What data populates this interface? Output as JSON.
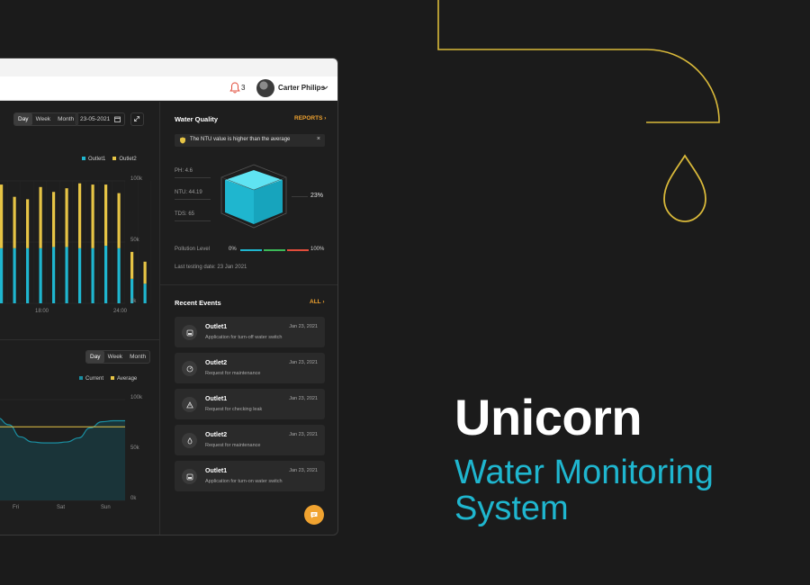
{
  "branding": {
    "title": "Unicorn",
    "subtitle": "Water Monitoring System"
  },
  "colors": {
    "accent_cyan": "#1fb6cf",
    "accent_yellow": "#e6c445",
    "accent_orange": "#f0a330",
    "pollution_red": "#e24d3b",
    "pollution_green": "#3cba58",
    "background": "#1b1b1b"
  },
  "header": {
    "notification_icon": "bell-icon",
    "notification_count": "3",
    "user_name": "Carter Philips",
    "menu_icon": "chevron-down-icon"
  },
  "usage_panel": {
    "range_buttons": [
      "Day",
      "Week",
      "Month"
    ],
    "active_range": "Day",
    "date": "23-05-2021",
    "legend": [
      "Outlet1",
      "Outlet2"
    ],
    "y_ticks": [
      "100k",
      "50k",
      "0k"
    ],
    "x_ticks": [
      "18:00",
      "24:00"
    ]
  },
  "flow_panel": {
    "range_buttons": [
      "Day",
      "Week",
      "Month"
    ],
    "active_range": "Day",
    "legend": [
      "Current",
      "Average"
    ],
    "y_ticks": [
      "100k",
      "50k",
      "0k"
    ],
    "x_ticks": [
      "Fri",
      "Sat",
      "Sun"
    ]
  },
  "chart_data": [
    {
      "type": "bar",
      "stacked": true,
      "series": [
        {
          "name": "Outlet1",
          "color": "#1fb6cf",
          "values": [
            45,
            45,
            45,
            45,
            46,
            46,
            45,
            45,
            47,
            45,
            20,
            16
          ]
        },
        {
          "name": "Outlet2",
          "color": "#e6c445",
          "values": [
            52,
            42,
            40,
            50,
            45,
            48,
            53,
            52,
            50,
            45,
            22,
            18
          ]
        }
      ],
      "ylim": [
        0,
        100
      ],
      "grid": true,
      "legend": "top-right"
    },
    {
      "type": "area",
      "series": [
        {
          "name": "Current",
          "color": "#1fb6cf",
          "values": [
            82,
            75,
            63,
            58,
            57,
            57,
            58,
            62,
            72,
            78,
            79,
            79
          ]
        },
        {
          "name": "Average",
          "color": "#e6c445",
          "values": [
            73,
            73,
            73,
            73,
            73,
            73,
            73,
            73,
            73,
            73,
            73,
            73
          ]
        }
      ],
      "ylim": [
        0,
        100
      ],
      "grid": true,
      "legend": "top-right"
    }
  ],
  "water_quality": {
    "title": "Water Quality",
    "link": "REPORTS",
    "alert": "The NTU value is higher than the average",
    "alert_close": "×",
    "metrics": [
      "PH: 4.6",
      "NTU: 44.19",
      "TDS: 65"
    ],
    "percentage": "23%",
    "pollution_label": "Pollution Level",
    "pollution_min": "0%",
    "pollution_max": "100%",
    "last_testing": "Last testing date: 23 Jan 2021"
  },
  "recent_events": {
    "title": "Recent Events",
    "link": "ALL",
    "items": [
      {
        "title": "Outlet1",
        "desc": "Application for turn-off water switch",
        "date": "Jan 23, 2021",
        "icon": "switch-icon"
      },
      {
        "title": "Outlet2",
        "desc": "Request for maintenance",
        "date": "Jan 23, 2021",
        "icon": "gauge-icon"
      },
      {
        "title": "Outlet1",
        "desc": "Request for checking leak",
        "date": "Jan 23, 2021",
        "icon": "warning-icon"
      },
      {
        "title": "Outlet2",
        "desc": "Request for maintenance",
        "date": "Jan 23, 2021",
        "icon": "drop-icon"
      },
      {
        "title": "Outlet1",
        "desc": "Application for turn-on water switch",
        "date": "Jan 23, 2021",
        "icon": "switch-icon"
      }
    ]
  },
  "chat": {
    "icon": "chat-icon"
  }
}
